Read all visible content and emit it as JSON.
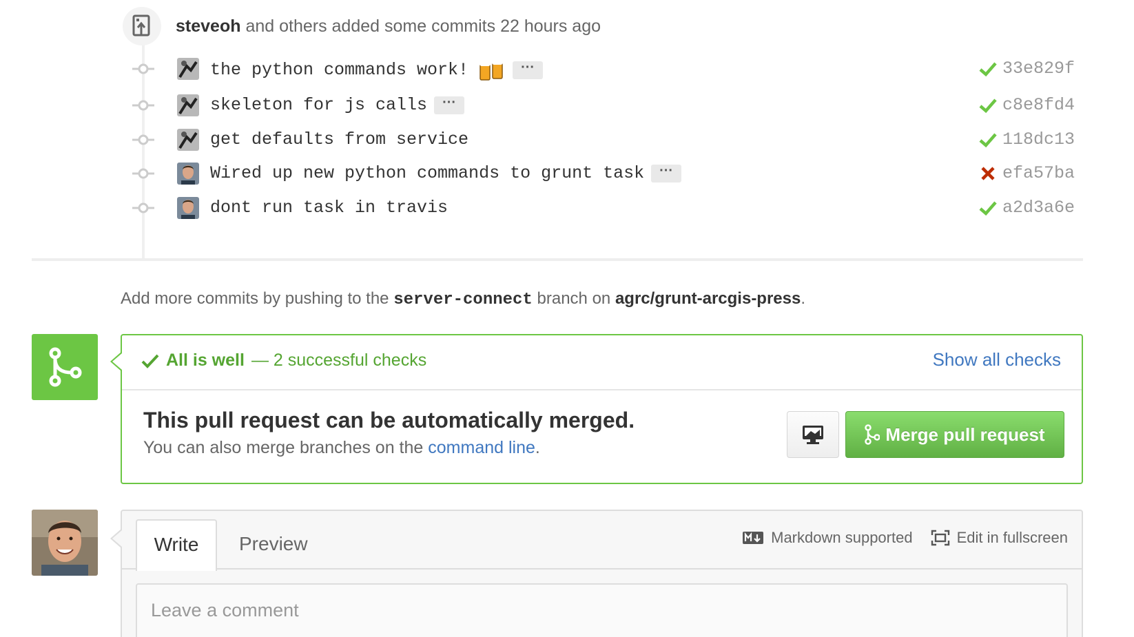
{
  "push_event": {
    "user": "steveoh",
    "text": "and others added some commits 22 hours ago"
  },
  "commits": [
    {
      "message": "the python commands work!",
      "has_emoji": true,
      "emoji_icon": "beers-emoji-icon",
      "has_ellipsis": true,
      "status": "success",
      "sha": "33e829f",
      "avatar": "avatar-a"
    },
    {
      "message": "skeleton for js calls",
      "has_emoji": false,
      "has_ellipsis": true,
      "status": "success",
      "sha": "c8e8fd4",
      "avatar": "avatar-a"
    },
    {
      "message": "get defaults from service",
      "has_emoji": false,
      "has_ellipsis": false,
      "status": "success",
      "sha": "118dc13",
      "avatar": "avatar-a"
    },
    {
      "message": "Wired up new python commands to grunt task",
      "has_emoji": false,
      "has_ellipsis": true,
      "status": "failure",
      "sha": "efa57ba",
      "avatar": "avatar-b"
    },
    {
      "message": "dont run task in travis",
      "has_emoji": false,
      "has_ellipsis": false,
      "status": "success",
      "sha": "a2d3a6e",
      "avatar": "avatar-b"
    }
  ],
  "ellipsis_label": "···",
  "add_commits": {
    "prefix": "Add more commits by pushing to the",
    "branch": "server-connect",
    "middle": "branch on",
    "repo": "agrc/grunt-arcgis-press",
    "suffix": "."
  },
  "merge": {
    "checks_title": "All is well",
    "checks_count": "— 2 successful checks",
    "show_checks": "Show all checks",
    "title": "This pull request can be automatically merged.",
    "sub_prefix": "You can also merge branches on the",
    "sub_link": "command line",
    "sub_suffix": ".",
    "button": "Merge pull request"
  },
  "comment": {
    "tab_write": "Write",
    "tab_preview": "Preview",
    "markdown": "Markdown supported",
    "fullscreen": "Edit in fullscreen",
    "placeholder": "Leave a comment"
  },
  "colors": {
    "success": "#6cc644",
    "failure": "#bd2c00",
    "link": "#4078c0"
  }
}
